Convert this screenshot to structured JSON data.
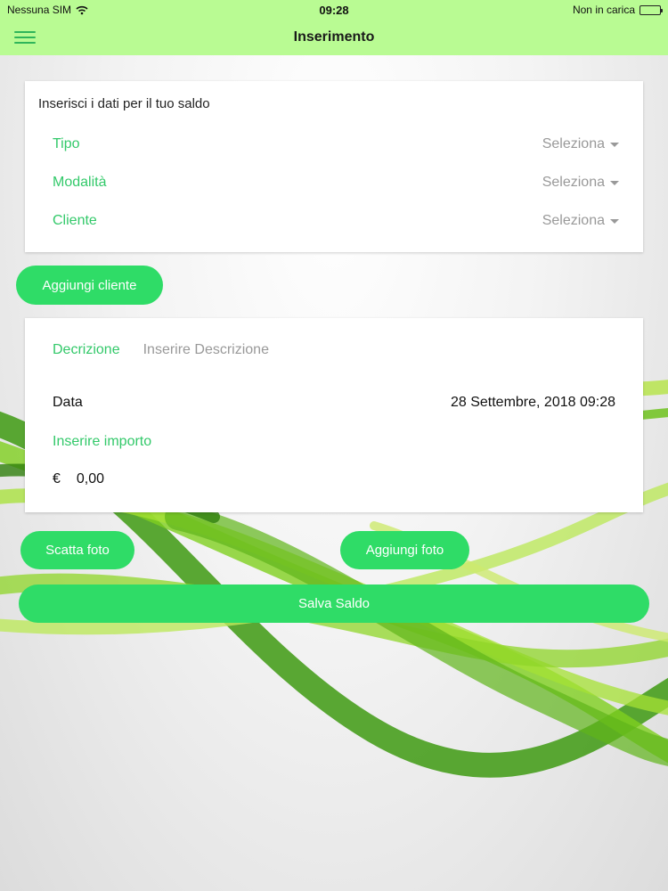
{
  "status_bar": {
    "carrier": "Nessuna SIM",
    "time": "09:28",
    "charging_status": "Non in carica",
    "wifi_icon": "wifi-icon",
    "battery_icon": "battery-icon"
  },
  "nav": {
    "title": "Inserimento",
    "menu_icon": "hamburger-menu-icon"
  },
  "form_card": {
    "heading": "Inserisci i dati per il tuo saldo",
    "selects": [
      {
        "label": "Tipo",
        "value": "Seleziona"
      },
      {
        "label": "Modalità",
        "value": "Seleziona"
      },
      {
        "label": "Cliente",
        "value": "Seleziona"
      }
    ]
  },
  "add_client_button": "Aggiungi cliente",
  "detail_card": {
    "description_label": "Decrizione",
    "description_placeholder": "Inserire Descrizione",
    "date_label": "Data",
    "date_value": "28 Settembre, 2018 09:28",
    "amount_label": "Inserire importo",
    "currency_symbol": "€",
    "amount_value": "0,00"
  },
  "buttons": {
    "take_photo": "Scatta foto",
    "add_photo": "Aggiungi foto",
    "save": "Salva Saldo"
  },
  "colors": {
    "header_bg": "#b9fb93",
    "accent_green": "#33c96a",
    "button_green": "#2fdc67"
  }
}
